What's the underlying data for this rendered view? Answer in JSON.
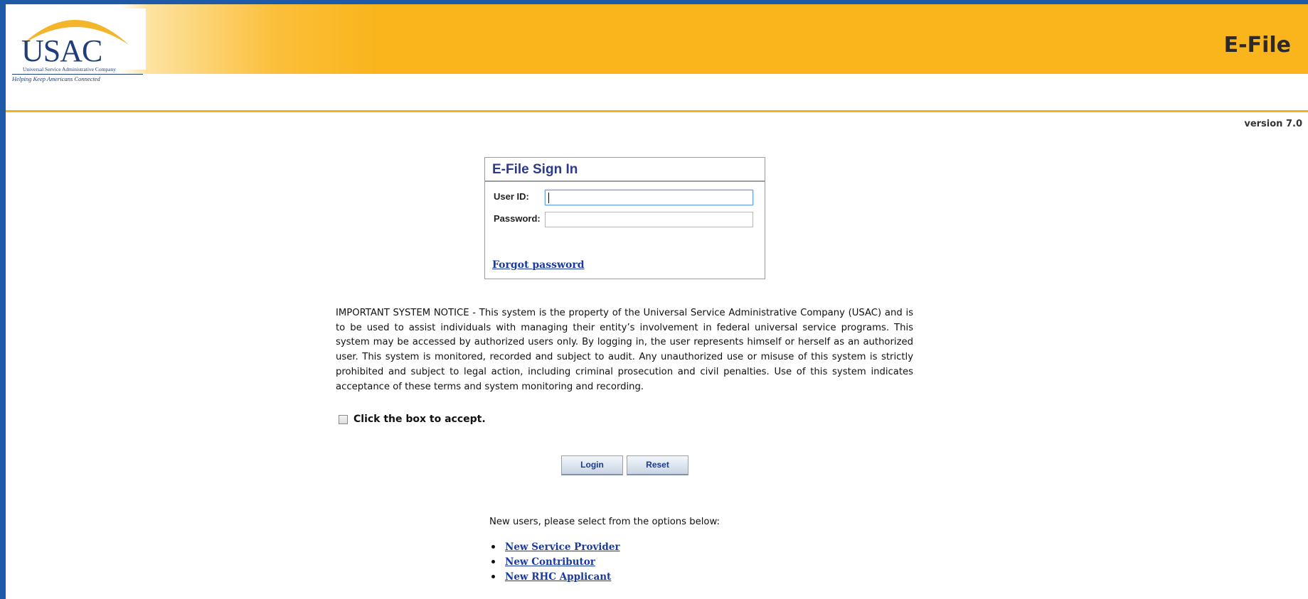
{
  "header": {
    "logo_text": "USAC",
    "logo_company": "Universal Service Administrative Company",
    "logo_tagline": "Helping Keep Americans Connected",
    "app_title": "E-File",
    "version": "version 7.0"
  },
  "signin": {
    "title": "E-File Sign In",
    "user_id_label": "User ID:",
    "user_id_value": "",
    "password_label": "Password:",
    "password_value": "",
    "forgot_password": "Forgot password"
  },
  "notice": {
    "text": "IMPORTANT SYSTEM NOTICE - This system is the property of the Universal Service Administrative Company (USAC) and is to be used to assist individuals with managing their entity’s involvement in federal universal service programs. This system may be accessed by authorized users only. By logging in, the user represents himself or herself as an authorized user. This system is monitored, recorded and subject to audit. Any unauthorized use or misuse of this system is strictly prohibited and subject to legal action, including criminal prosecution and civil penalties. Use of this system indicates acceptance of these terms and system monitoring and recording.",
    "accept_label": "Click the box to accept.",
    "accepted": false
  },
  "buttons": {
    "login": "Login",
    "reset": "Reset"
  },
  "new_users": {
    "intro": "New users, please select from the options below:",
    "links": [
      "New Service Provider",
      "New Contributor",
      "New RHC Applicant"
    ]
  },
  "colors": {
    "brand_blue": "#1f3e7a",
    "header_gold": "#fab51c",
    "link_blue": "#1a3a9e",
    "frame_blue": "#1e5aa8"
  }
}
